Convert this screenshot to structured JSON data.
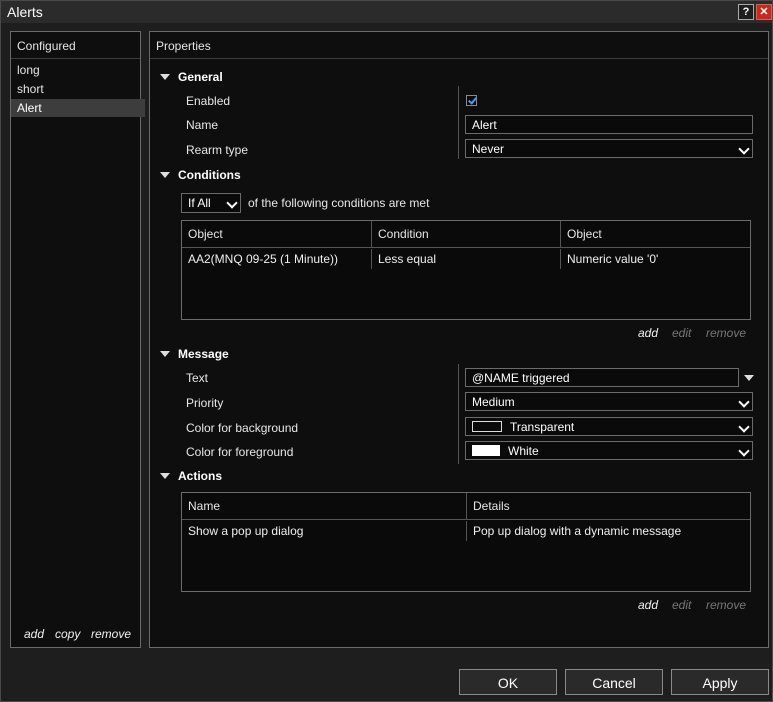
{
  "window": {
    "title": "Alerts"
  },
  "titlebar": {
    "help_label": "?",
    "close_label": "✕"
  },
  "configured": {
    "header": "Configured",
    "items": [
      "long",
      "short",
      "Alert"
    ],
    "selected": "Alert",
    "actions": {
      "add": "add",
      "copy": "copy",
      "remove": "remove"
    }
  },
  "properties": {
    "header": "Properties",
    "general": {
      "title": "General",
      "enabled_label": "Enabled",
      "enabled": true,
      "name_label": "Name",
      "name_value": "Alert",
      "rearm_label": "Rearm type",
      "rearm_value": "Never"
    },
    "conditions": {
      "title": "Conditions",
      "mode_value": "If All",
      "mode_suffix": "of the following conditions are met",
      "columns": [
        "Object",
        "Condition",
        "Object"
      ],
      "rows": [
        [
          "AA2(MNQ 09-25 (1 Minute))",
          "Less equal",
          "Numeric value '0'"
        ]
      ],
      "actions": {
        "add": "add",
        "edit": "edit",
        "remove": "remove"
      }
    },
    "message": {
      "title": "Message",
      "text_label": "Text",
      "text_value": "@NAME triggered",
      "priority_label": "Priority",
      "priority_value": "Medium",
      "bg_label": "Color for background",
      "bg_value": "Transparent",
      "fg_label": "Color for foreground",
      "fg_value": "White"
    },
    "actions": {
      "title": "Actions",
      "columns": [
        "Name",
        "Details"
      ],
      "rows": [
        [
          "Show a pop up dialog",
          "Pop up dialog with a dynamic message"
        ]
      ],
      "links": {
        "add": "add",
        "edit": "edit",
        "remove": "remove"
      }
    }
  },
  "buttons": {
    "ok": "OK",
    "cancel": "Cancel",
    "apply": "Apply"
  },
  "colors": {
    "accent": "#3aa0ff",
    "close": "#c42b1c",
    "background": "#1e1e1e",
    "panel": "#0e0e0e"
  },
  "icons": {
    "help": "help-icon",
    "close": "close-icon",
    "expand": "triangle-down-icon",
    "dropdown": "chevron-down-icon",
    "check": "checkmark-icon"
  }
}
